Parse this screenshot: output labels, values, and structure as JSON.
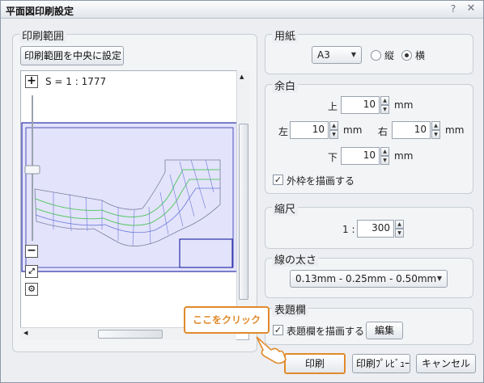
{
  "window": {
    "title": "平面図印刷設定",
    "help_glyph": "?",
    "close_glyph": "✕"
  },
  "print_range": {
    "group_label": "印刷範囲",
    "center_button": "印刷範囲を中央に設定",
    "scale_text": "S = 1 : 1777",
    "zoom_in": "+",
    "zoom_out": "−"
  },
  "paper": {
    "group_label": "用紙",
    "size_value": "A3",
    "orientation_portrait": "縦",
    "orientation_landscape": "横",
    "selected": "横"
  },
  "margin": {
    "group_label": "余白",
    "top_label": "上",
    "top_value": "10",
    "left_label": "左",
    "left_value": "10",
    "right_label": "右",
    "right_value": "10",
    "bottom_label": "下",
    "bottom_value": "10",
    "unit": "mm",
    "outer_frame_label": "外枠を描画する",
    "outer_frame_checked": true
  },
  "scale": {
    "group_label": "縮尺",
    "prefix": "1 :",
    "value": "300"
  },
  "line_width": {
    "group_label": "線の太さ",
    "value": "0.13mm - 0.25mm - 0.50mm"
  },
  "title_block": {
    "group_label": "表題欄",
    "draw_label": "表題欄を描画する",
    "draw_checked": true,
    "edit_button": "編集"
  },
  "footer": {
    "print_button": "印刷",
    "preview_button": "印刷ﾌﾟﾚﾋﾞｭｰ",
    "cancel_button": "キャンセル"
  },
  "annotation": {
    "callout_text": "ここをクリック"
  },
  "colors": {
    "accent": "#e08a2c",
    "frame": "#2a2fa8",
    "paper_fill": "#e3e3fb",
    "road_green": "#5cc96a",
    "road_blue": "#6a78d8"
  }
}
